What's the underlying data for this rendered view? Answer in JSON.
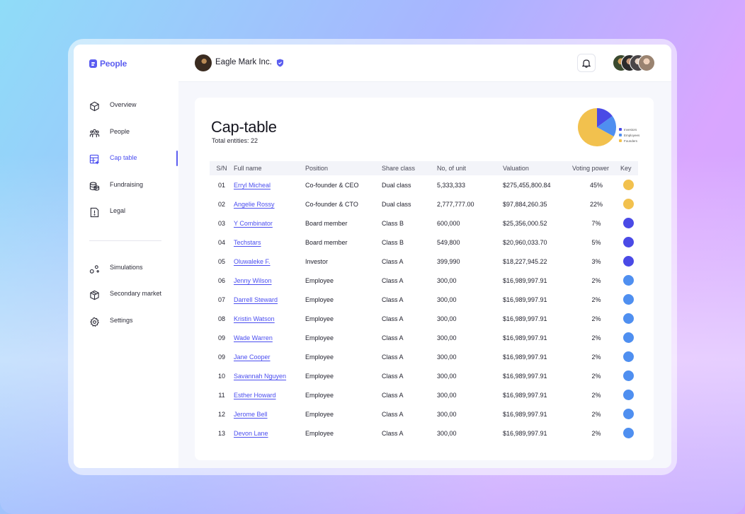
{
  "app": {
    "logo_text": "People"
  },
  "company": {
    "name": "Eagle Mark Inc."
  },
  "sidebar": {
    "items": [
      {
        "label": "Overview",
        "icon": "cube-icon"
      },
      {
        "label": "People",
        "icon": "people-icon"
      },
      {
        "label": "Cap table",
        "icon": "table-icon",
        "active": true
      },
      {
        "label": "Fundraising",
        "icon": "coins-icon"
      },
      {
        "label": "Legal",
        "icon": "document-icon"
      }
    ],
    "items2": [
      {
        "label": "Simulations",
        "icon": "nodes-icon"
      },
      {
        "label": "Secondary market",
        "icon": "box-icon"
      },
      {
        "label": "Settings",
        "icon": "gear-icon"
      }
    ]
  },
  "page": {
    "title": "Cap-table",
    "subtitle": "Total entities: 22"
  },
  "colors": {
    "investors": "#4a4ae6",
    "employees": "#4f8ff0",
    "founders": "#f2c14e",
    "accent": "#5b5df0"
  },
  "chart_data": {
    "type": "pie",
    "labels": [
      "Investors",
      "Employees",
      "Founders"
    ],
    "values": [
      15,
      18,
      67
    ],
    "colors": [
      "#4a4ae6",
      "#4f8ff0",
      "#f2c14e"
    ]
  },
  "table": {
    "headers": [
      "S/N",
      "Full name",
      "Position",
      "Share class",
      "No, of unit",
      "Valuation",
      "Voting power",
      "Key"
    ],
    "rows": [
      {
        "sn": "01",
        "name": "Erryl Micheal",
        "position": "Co-founder & CEO",
        "share_class": "Dual class",
        "units": "5,333,333",
        "valuation": "$275,455,800.84",
        "voting": "45%",
        "key": "founders"
      },
      {
        "sn": "02",
        "name": "Angelie Rossy",
        "position": "Co-founder & CTO",
        "share_class": "Dual class",
        "units": "2,777,777.00",
        "valuation": "$97,884,260.35",
        "voting": "22%",
        "key": "founders"
      },
      {
        "sn": "03",
        "name": "Y Combinator",
        "position": "Board member",
        "share_class": "Class B",
        "units": "600,000",
        "valuation": "$25,356,000.52",
        "voting": "7%",
        "key": "investors"
      },
      {
        "sn": "04",
        "name": "Techstars",
        "position": "Board member",
        "share_class": "Class B",
        "units": "549,800",
        "valuation": "$20,960,033.70",
        "voting": "5%",
        "key": "investors"
      },
      {
        "sn": "05",
        "name": "Oluwaleke F.",
        "position": "Investor",
        "share_class": "Class A",
        "units": "399,990",
        "valuation": "$18,227,945.22",
        "voting": "3%",
        "key": "investors"
      },
      {
        "sn": "06",
        "name": "Jenny Wilson",
        "position": "Employee",
        "share_class": "Class A",
        "units": "300,00",
        "valuation": "$16,989,997.91",
        "voting": "2%",
        "key": "employees"
      },
      {
        "sn": "07",
        "name": "Darrell Steward",
        "position": "Employee",
        "share_class": "Class A",
        "units": "300,00",
        "valuation": "$16,989,997.91",
        "voting": "2%",
        "key": "employees"
      },
      {
        "sn": "08",
        "name": "Kristin Watson",
        "position": "Employee",
        "share_class": "Class A",
        "units": "300,00",
        "valuation": "$16,989,997.91",
        "voting": "2%",
        "key": "employees"
      },
      {
        "sn": "09",
        "name": "Wade Warren",
        "position": "Employee",
        "share_class": "Class A",
        "units": "300,00",
        "valuation": "$16,989,997.91",
        "voting": "2%",
        "key": "employees"
      },
      {
        "sn": "09",
        "name": "Jane Cooper",
        "position": "Employee",
        "share_class": "Class A",
        "units": "300,00",
        "valuation": "$16,989,997.91",
        "voting": "2%",
        "key": "employees"
      },
      {
        "sn": "10",
        "name": "Savannah Nguyen",
        "position": "Employee",
        "share_class": "Class A",
        "units": "300,00",
        "valuation": "$16,989,997.91",
        "voting": "2%",
        "key": "employees"
      },
      {
        "sn": "11",
        "name": "Esther Howard",
        "position": "Employee",
        "share_class": "Class A",
        "units": "300,00",
        "valuation": "$16,989,997.91",
        "voting": "2%",
        "key": "employees"
      },
      {
        "sn": "12",
        "name": "Jerome Bell",
        "position": "Employee",
        "share_class": "Class A",
        "units": "300,00",
        "valuation": "$16,989,997.91",
        "voting": "2%",
        "key": "employees"
      },
      {
        "sn": "13",
        "name": "Devon Lane",
        "position": "Employee",
        "share_class": "Class A",
        "units": "300,00",
        "valuation": "$16,989,997.91",
        "voting": "2%",
        "key": "employees"
      }
    ]
  }
}
